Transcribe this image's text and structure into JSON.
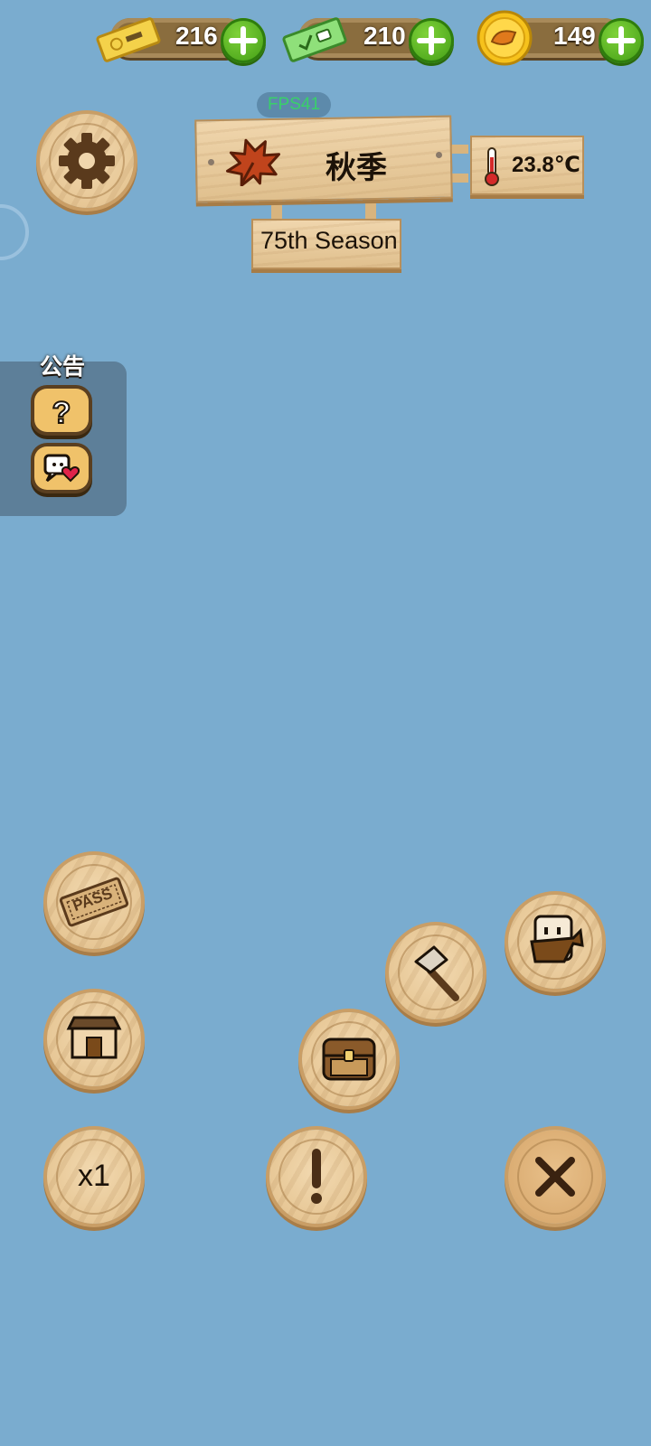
{
  "currencies": [
    {
      "name": "gold-ticket",
      "value": "216"
    },
    {
      "name": "green-ticket",
      "value": "210"
    },
    {
      "name": "coin",
      "value": "149"
    }
  ],
  "fps": "FPS41",
  "season": {
    "name": "秋季",
    "number_label": "75th Season",
    "temperature": "23.8℃"
  },
  "announcement": {
    "title": "公告"
  },
  "buttons": {
    "pass_label": "PASS",
    "speed_label": "x1"
  },
  "colors": {
    "background": "#7aaccf",
    "wood": "#e8c99a",
    "plus_green": "#4caf1a",
    "leaf": "#c0441c"
  }
}
